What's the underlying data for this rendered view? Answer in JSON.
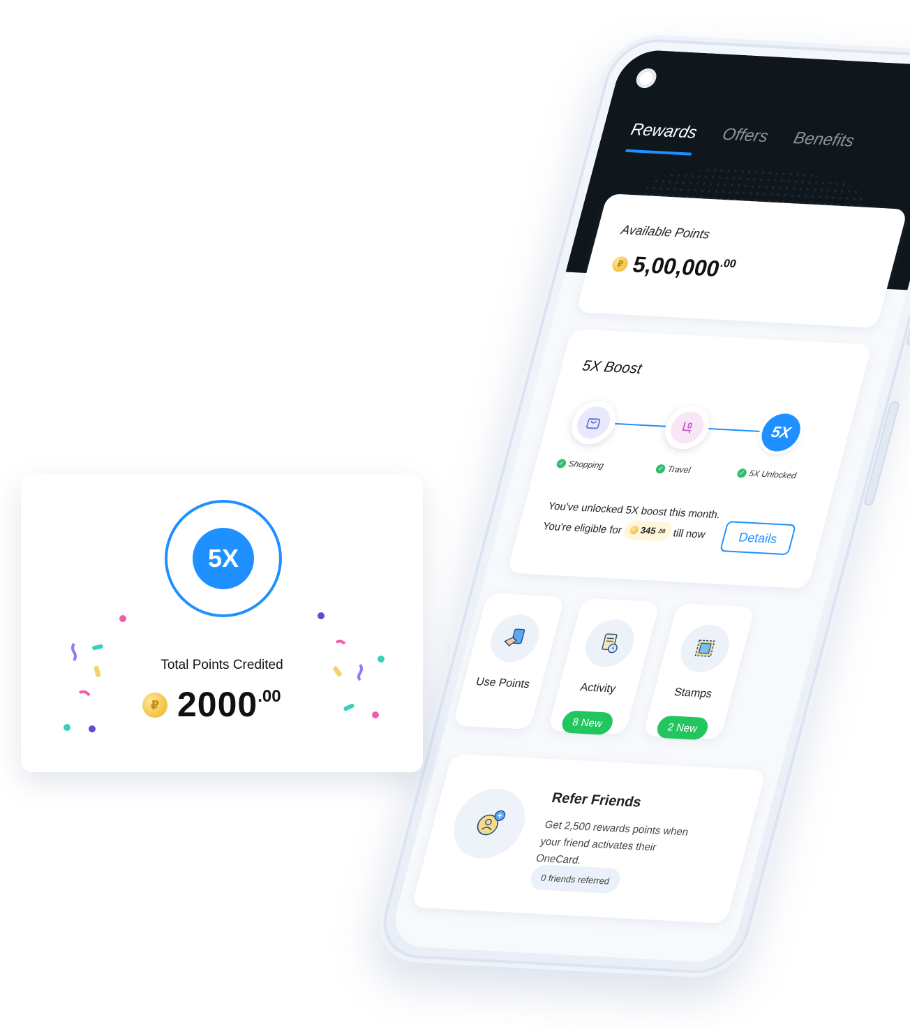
{
  "tabs": [
    {
      "label": "Rewards",
      "active": true
    },
    {
      "label": "Offers",
      "active": false
    },
    {
      "label": "Benefits",
      "active": false
    }
  ],
  "points": {
    "label": "Available Points",
    "value": "5,00,000",
    "decimals": ".00",
    "coin_symbol": "₽"
  },
  "boost": {
    "title": "5X Boost",
    "steps": [
      {
        "label": "Shopping",
        "icon": "shopping-bag-icon"
      },
      {
        "label": "Travel",
        "icon": "seat-icon"
      },
      {
        "label": "5X Unlocked",
        "badge": "5X"
      }
    ],
    "message_line1": "You've unlocked 5X boost this month.",
    "message_line2_prefix": "You're eligible for",
    "eligible_value": "345",
    "eligible_decimals": ".00",
    "message_line2_suffix": "till now",
    "details_label": "Details"
  },
  "tiles": [
    {
      "label": "Use Points",
      "icon": "card-hand-icon"
    },
    {
      "label": "Activity",
      "icon": "receipt-clock-icon",
      "badge": "8 New"
    },
    {
      "label": "Stamps",
      "icon": "stamp-icon",
      "badge": "2 New"
    }
  ],
  "refer": {
    "title": "Refer Friends",
    "text": "Get 2,500 rewards points when your friend activates their OneCard.",
    "pill": "0 friends referred"
  },
  "credit_card": {
    "badge": "5X",
    "label": "Total Points Credited",
    "value": "2000",
    "decimals": ".00"
  },
  "colors": {
    "accent": "#1e90ff",
    "dark_header": "#0f171c",
    "success": "#22c55e",
    "coin": "#f3c043"
  }
}
